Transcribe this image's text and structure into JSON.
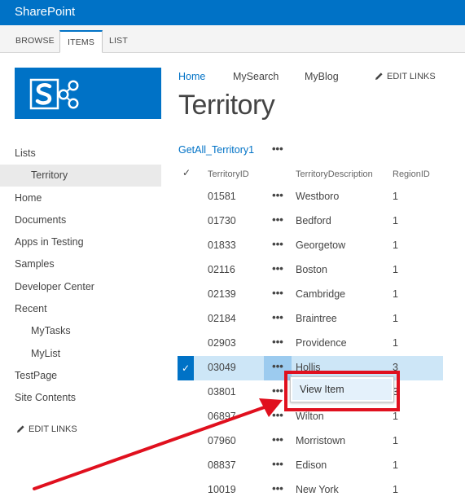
{
  "suite_bar": {
    "brand": "SharePoint"
  },
  "ribbon": {
    "tabs": [
      {
        "label": "BROWSE"
      },
      {
        "label": "ITEMS"
      },
      {
        "label": "LIST"
      }
    ]
  },
  "top_nav": {
    "links": [
      "Home",
      "MySearch",
      "MyBlog"
    ],
    "edit_links": "EDIT LINKS"
  },
  "page_title": "Territory",
  "quick_launch": {
    "items": [
      "Lists",
      "Territory",
      "Home",
      "Documents",
      "Apps in Testing",
      "Samples",
      "Developer Center",
      "Recent",
      "MyTasks",
      "MyList",
      "TestPage",
      "Site Contents"
    ],
    "selected": "Territory",
    "edit_links": "EDIT LINKS"
  },
  "list_view": {
    "view_name": "GetAll_Territory1",
    "ellipsis": "•••",
    "check_symbol": "✓",
    "columns": [
      "TerritoryID",
      "TerritoryDescription",
      "RegionID"
    ],
    "rows": [
      {
        "id": "01581",
        "desc": "Westboro",
        "region": "1"
      },
      {
        "id": "01730",
        "desc": "Bedford",
        "region": "1"
      },
      {
        "id": "01833",
        "desc": "Georgetow",
        "region": "1"
      },
      {
        "id": "02116",
        "desc": "Boston",
        "region": "1"
      },
      {
        "id": "02139",
        "desc": "Cambridge",
        "region": "1"
      },
      {
        "id": "02184",
        "desc": "Braintree",
        "region": "1"
      },
      {
        "id": "02903",
        "desc": "Providence",
        "region": "1"
      },
      {
        "id": "03049",
        "desc": "Hollis",
        "region": "3"
      },
      {
        "id": "03801",
        "desc": "Portsmouth",
        "region": "3"
      },
      {
        "id": "06897",
        "desc": "Wilton",
        "region": "1"
      },
      {
        "id": "07960",
        "desc": "Morristown",
        "region": "1"
      },
      {
        "id": "08837",
        "desc": "Edison",
        "region": "1"
      },
      {
        "id": "10019",
        "desc": "New York",
        "region": "1"
      }
    ],
    "selected_row": "03049"
  },
  "context_menu": {
    "items": [
      "View Item"
    ]
  },
  "colors": {
    "suite_bar": "#0072c6",
    "link": "#0072c6",
    "selected_row": "#cde6f7",
    "annotation": "#e0101e"
  }
}
